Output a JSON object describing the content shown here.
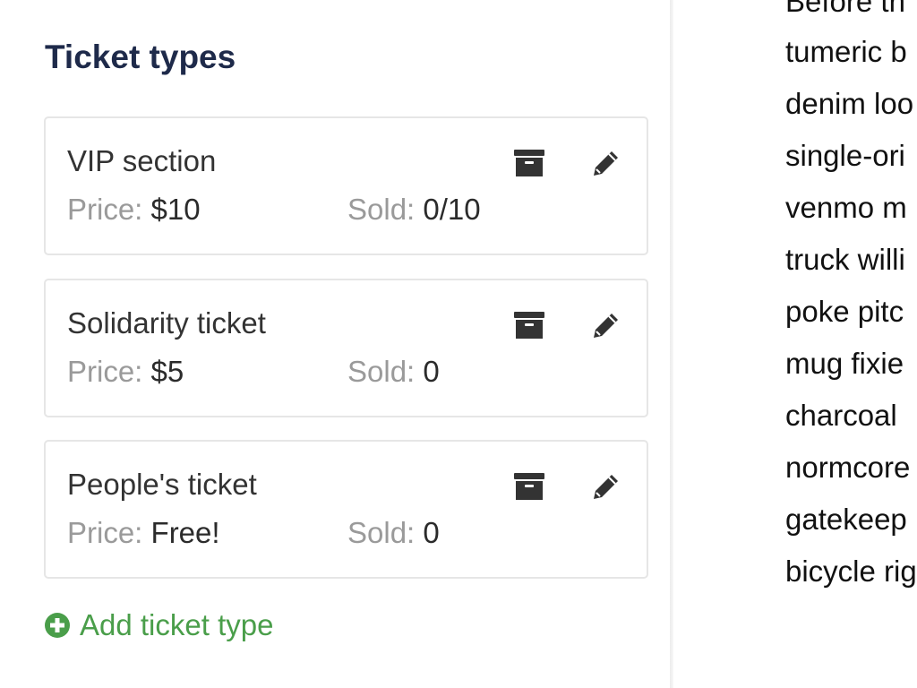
{
  "ticket_types": {
    "title": "Ticket types",
    "price_label": "Price:",
    "sold_label": "Sold:",
    "items": [
      {
        "name": "VIP section",
        "price": "$10",
        "sold": "0/10"
      },
      {
        "name": "Solidarity ticket",
        "price": "$5",
        "sold": "0"
      },
      {
        "name": "People's ticket",
        "price": "Free!",
        "sold": "0"
      }
    ],
    "add_label": "Add ticket type"
  },
  "icons": {
    "archive": "archive-icon",
    "edit": "pencil-icon",
    "add": "plus-circle-icon"
  },
  "colors": {
    "title": "#1e2a4a",
    "add_link": "#4a9e4a",
    "muted_label": "#9a9a9a"
  },
  "description": {
    "lines": [
      "Before th",
      "tumeric b",
      "denim loo",
      "single-ori",
      "venmo m",
      "truck willi",
      "poke pitc",
      "mug fixie",
      "charcoal",
      "normcore",
      "gatekeep",
      "bicycle rig"
    ]
  }
}
